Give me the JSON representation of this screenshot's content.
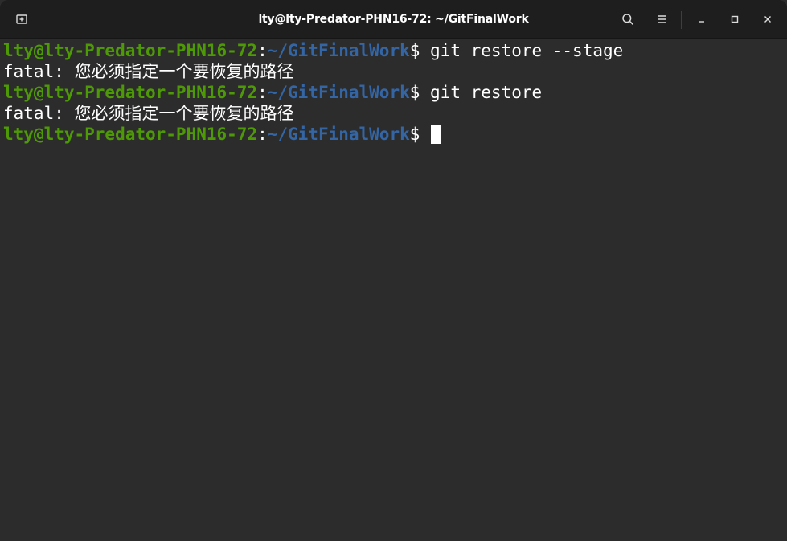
{
  "window": {
    "title": "lty@lty-Predator-PHN16-72: ~/GitFinalWork"
  },
  "titlebar": {
    "new_tab_icon": "new-tab-icon",
    "search_icon": "search-icon",
    "menu_icon": "hamburger-menu-icon",
    "minimize_icon": "minimize-icon",
    "maximize_icon": "maximize-icon",
    "close_icon": "close-icon"
  },
  "colors": {
    "user_host": "#4e9a06",
    "path": "#3465a4",
    "text": "#ffffff",
    "background": "#2c2c2c",
    "titlebar": "#1e1e1e"
  },
  "terminal": {
    "lines": [
      {
        "user": "lty@lty-Predator-PHN16-72",
        "sep": ":",
        "path": "~/GitFinalWork",
        "prompt": "$ ",
        "command": "git restore --stage"
      },
      {
        "output": "fatal: 您必须指定一个要恢复的路径"
      },
      {
        "user": "lty@lty-Predator-PHN16-72",
        "sep": ":",
        "path": "~/GitFinalWork",
        "prompt": "$ ",
        "command": "git restore"
      },
      {
        "output": "fatal: 您必须指定一个要恢复的路径"
      },
      {
        "user": "lty@lty-Predator-PHN16-72",
        "sep": ":",
        "path": "~/GitFinalWork",
        "prompt": "$ ",
        "command": ""
      }
    ]
  }
}
